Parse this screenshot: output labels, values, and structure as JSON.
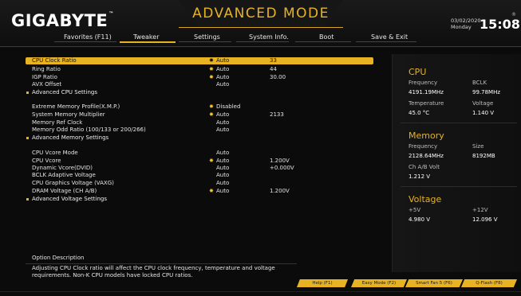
{
  "header": {
    "brand": "GIGABYTE",
    "brand_tm": "™",
    "mode_title": "ADVANCED MODE",
    "date": "03/02/2020",
    "day": "Monday",
    "time": "15:08",
    "reg": "®"
  },
  "nav": {
    "tabs": [
      {
        "label": "Favorites (F11)",
        "active": false
      },
      {
        "label": "Tweaker",
        "active": true
      },
      {
        "label": "Settings",
        "active": false
      },
      {
        "label": "System Info.",
        "active": false
      },
      {
        "label": "Boot",
        "active": false
      },
      {
        "label": "Save & Exit",
        "active": false
      }
    ]
  },
  "settings": {
    "rows": [
      {
        "label": "CPU Clock Ratio",
        "star": "✸",
        "value": "Auto",
        "current": "33",
        "selected": true
      },
      {
        "label": "Ring Ratio",
        "star": "✸",
        "value": "Auto",
        "current": "44"
      },
      {
        "label": "IGP Ratio",
        "star": "✸",
        "value": "Auto",
        "current": "30.00"
      },
      {
        "label": "AVX Offset",
        "star": "",
        "value": "Auto",
        "current": ""
      },
      {
        "label": "Advanced CPU Settings",
        "submenu": true
      },
      {
        "label": "Extreme Memory Profile(X.M.P.)",
        "star": "✸",
        "value": "Disabled",
        "current": ""
      },
      {
        "label": "System Memory Multiplier",
        "star": "✸",
        "value": "Auto",
        "current": "2133"
      },
      {
        "label": "Memory Ref Clock",
        "star": "",
        "value": "Auto",
        "current": ""
      },
      {
        "label": "Memory Odd Ratio (100/133 or 200/266)",
        "star": "",
        "value": "Auto",
        "current": ""
      },
      {
        "label": "Advanced Memory Settings",
        "submenu": true
      },
      {
        "label": "CPU Vcore Mode",
        "star": "",
        "value": "Auto",
        "current": ""
      },
      {
        "label": "CPU Vcore",
        "star": "✸",
        "value": "Auto",
        "current": "1.200V"
      },
      {
        "label": "Dynamic Vcore(DVID)",
        "star": "",
        "value": "Auto",
        "current": "+0.000V"
      },
      {
        "label": "BCLK Adaptive Voltage",
        "star": "",
        "value": "Auto",
        "current": ""
      },
      {
        "label": "CPU Graphics Voltage (VAXG)",
        "star": "",
        "value": "Auto",
        "current": ""
      },
      {
        "label": "DRAM Voltage    (CH A/B)",
        "star": "✸",
        "value": "Auto",
        "current": "1.200V"
      },
      {
        "label": "Advanced Voltage Settings",
        "submenu": true
      }
    ]
  },
  "side": {
    "cpu": {
      "title": "CPU",
      "freq_label": "Frequency",
      "freq": "4191.19MHz",
      "bclk_label": "BCLK",
      "bclk": "99.78MHz",
      "temp_label": "Temperature",
      "temp": "45.0 °C",
      "volt_label": "Voltage",
      "volt": "1.140 V"
    },
    "memory": {
      "title": "Memory",
      "freq_label": "Frequency",
      "freq": "2128.64MHz",
      "size_label": "Size",
      "size": "8192MB",
      "chab_label": "Ch A/B Volt",
      "chab": "1.212 V"
    },
    "voltage": {
      "title": "Voltage",
      "p5_label": "+5V",
      "p5": "4.980 V",
      "p12_label": "+12V",
      "p12": "12.096 V"
    }
  },
  "option": {
    "title": "Option Description",
    "text": "Adjusting CPU Clock ratio will affect the CPU clock frequency, temperature and voltage requirements. Non-K CPU models have locked CPU ratios."
  },
  "buttons": {
    "help": "Help (F1)",
    "easy": "Easy Mode (F2)",
    "smartfan": "Smart Fan 5 (F6)",
    "qflash": "Q-Flash (F8)"
  },
  "colors": {
    "accent": "#e8b323",
    "background": "#0b0b0b"
  }
}
